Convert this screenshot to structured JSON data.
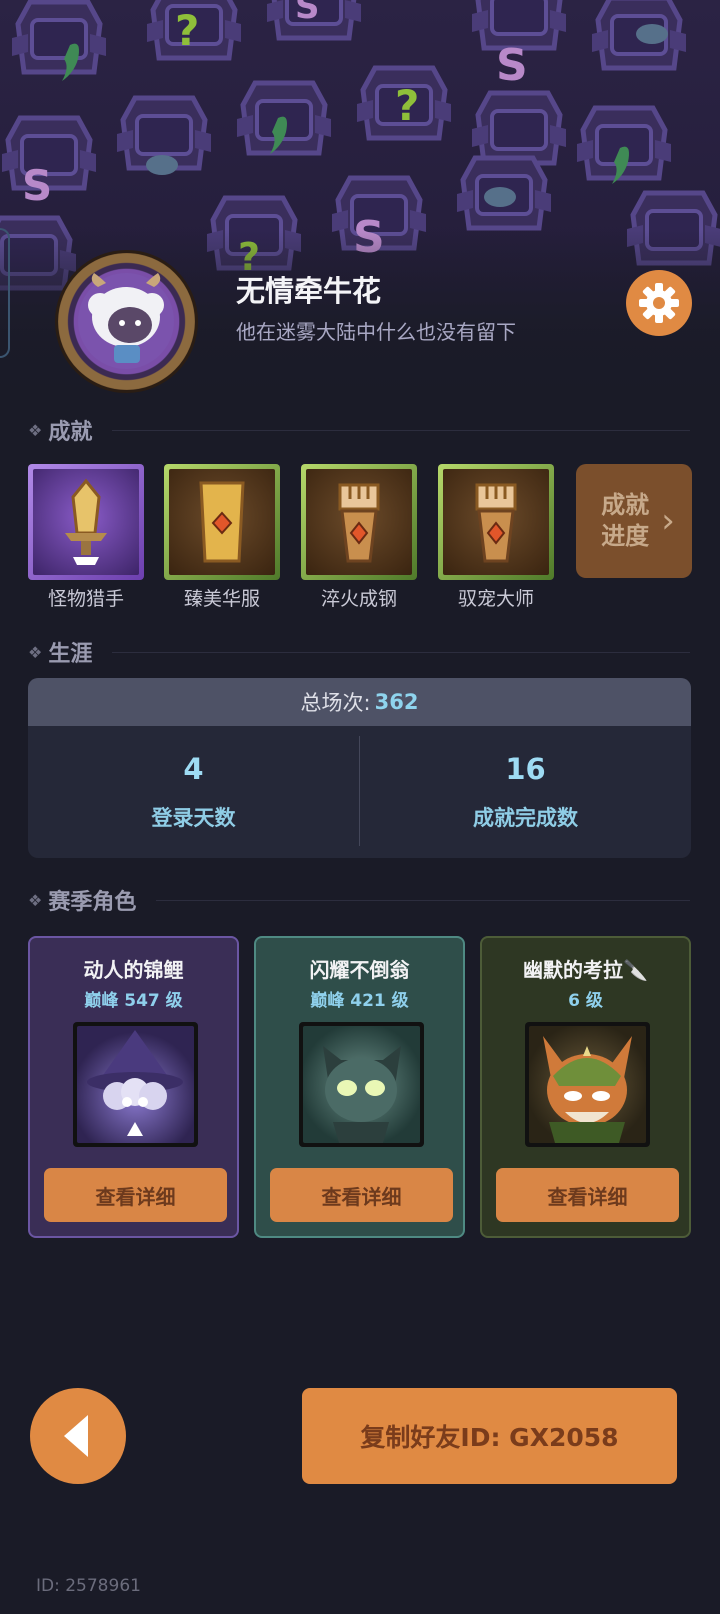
{
  "profile": {
    "nickname": "无情牵牛花",
    "signature": "他在迷雾大陆中什么也没有留下"
  },
  "icons": {
    "settings": "gear-icon",
    "back": "back-arrow-icon",
    "achievement_progress": "chevron-right-icon"
  },
  "sections": {
    "achievements": "成就",
    "career": "生涯",
    "season_heroes": "赛季角色"
  },
  "achievements": {
    "items": [
      {
        "label": "怪物猎手",
        "icon": "sword-crystal-icon",
        "frame": "purple"
      },
      {
        "label": "臻美华服",
        "icon": "golden-cloth-icon",
        "frame": "green"
      },
      {
        "label": "淬火成钢",
        "icon": "fist-icon",
        "frame": "green"
      },
      {
        "label": "驭宠大师",
        "icon": "fist-icon",
        "frame": "green"
      }
    ],
    "progress_label": "成就进度",
    "progress_line1": "成就",
    "progress_line2": "进度"
  },
  "career": {
    "total_label": "总场次:",
    "total_value": "362",
    "stats": [
      {
        "value": "4",
        "label": "登录天数"
      },
      {
        "value": "16",
        "label": "成就完成数"
      }
    ]
  },
  "heroes": [
    {
      "name": "动人的锦鲤",
      "level": "巅峰 547 级",
      "button": "查看详细",
      "theme": "purple",
      "portrait": "witch-portrait"
    },
    {
      "name": "闪耀不倒翁",
      "level": "巅峰 421 级",
      "button": "查看详细",
      "theme": "teal",
      "portrait": "robot-portrait"
    },
    {
      "name": "幽默的考拉🔪",
      "level": "6 级",
      "button": "查看详细",
      "theme": "olive",
      "portrait": "fox-portrait"
    }
  ],
  "actions": {
    "copy_friend_id": "复制好友ID: GX2058"
  },
  "footer": {
    "id_text": "ID: 2578961"
  },
  "colors": {
    "accent": "#e08a43",
    "background": "#1a1b27",
    "stat_blue": "#8fd4ee"
  }
}
